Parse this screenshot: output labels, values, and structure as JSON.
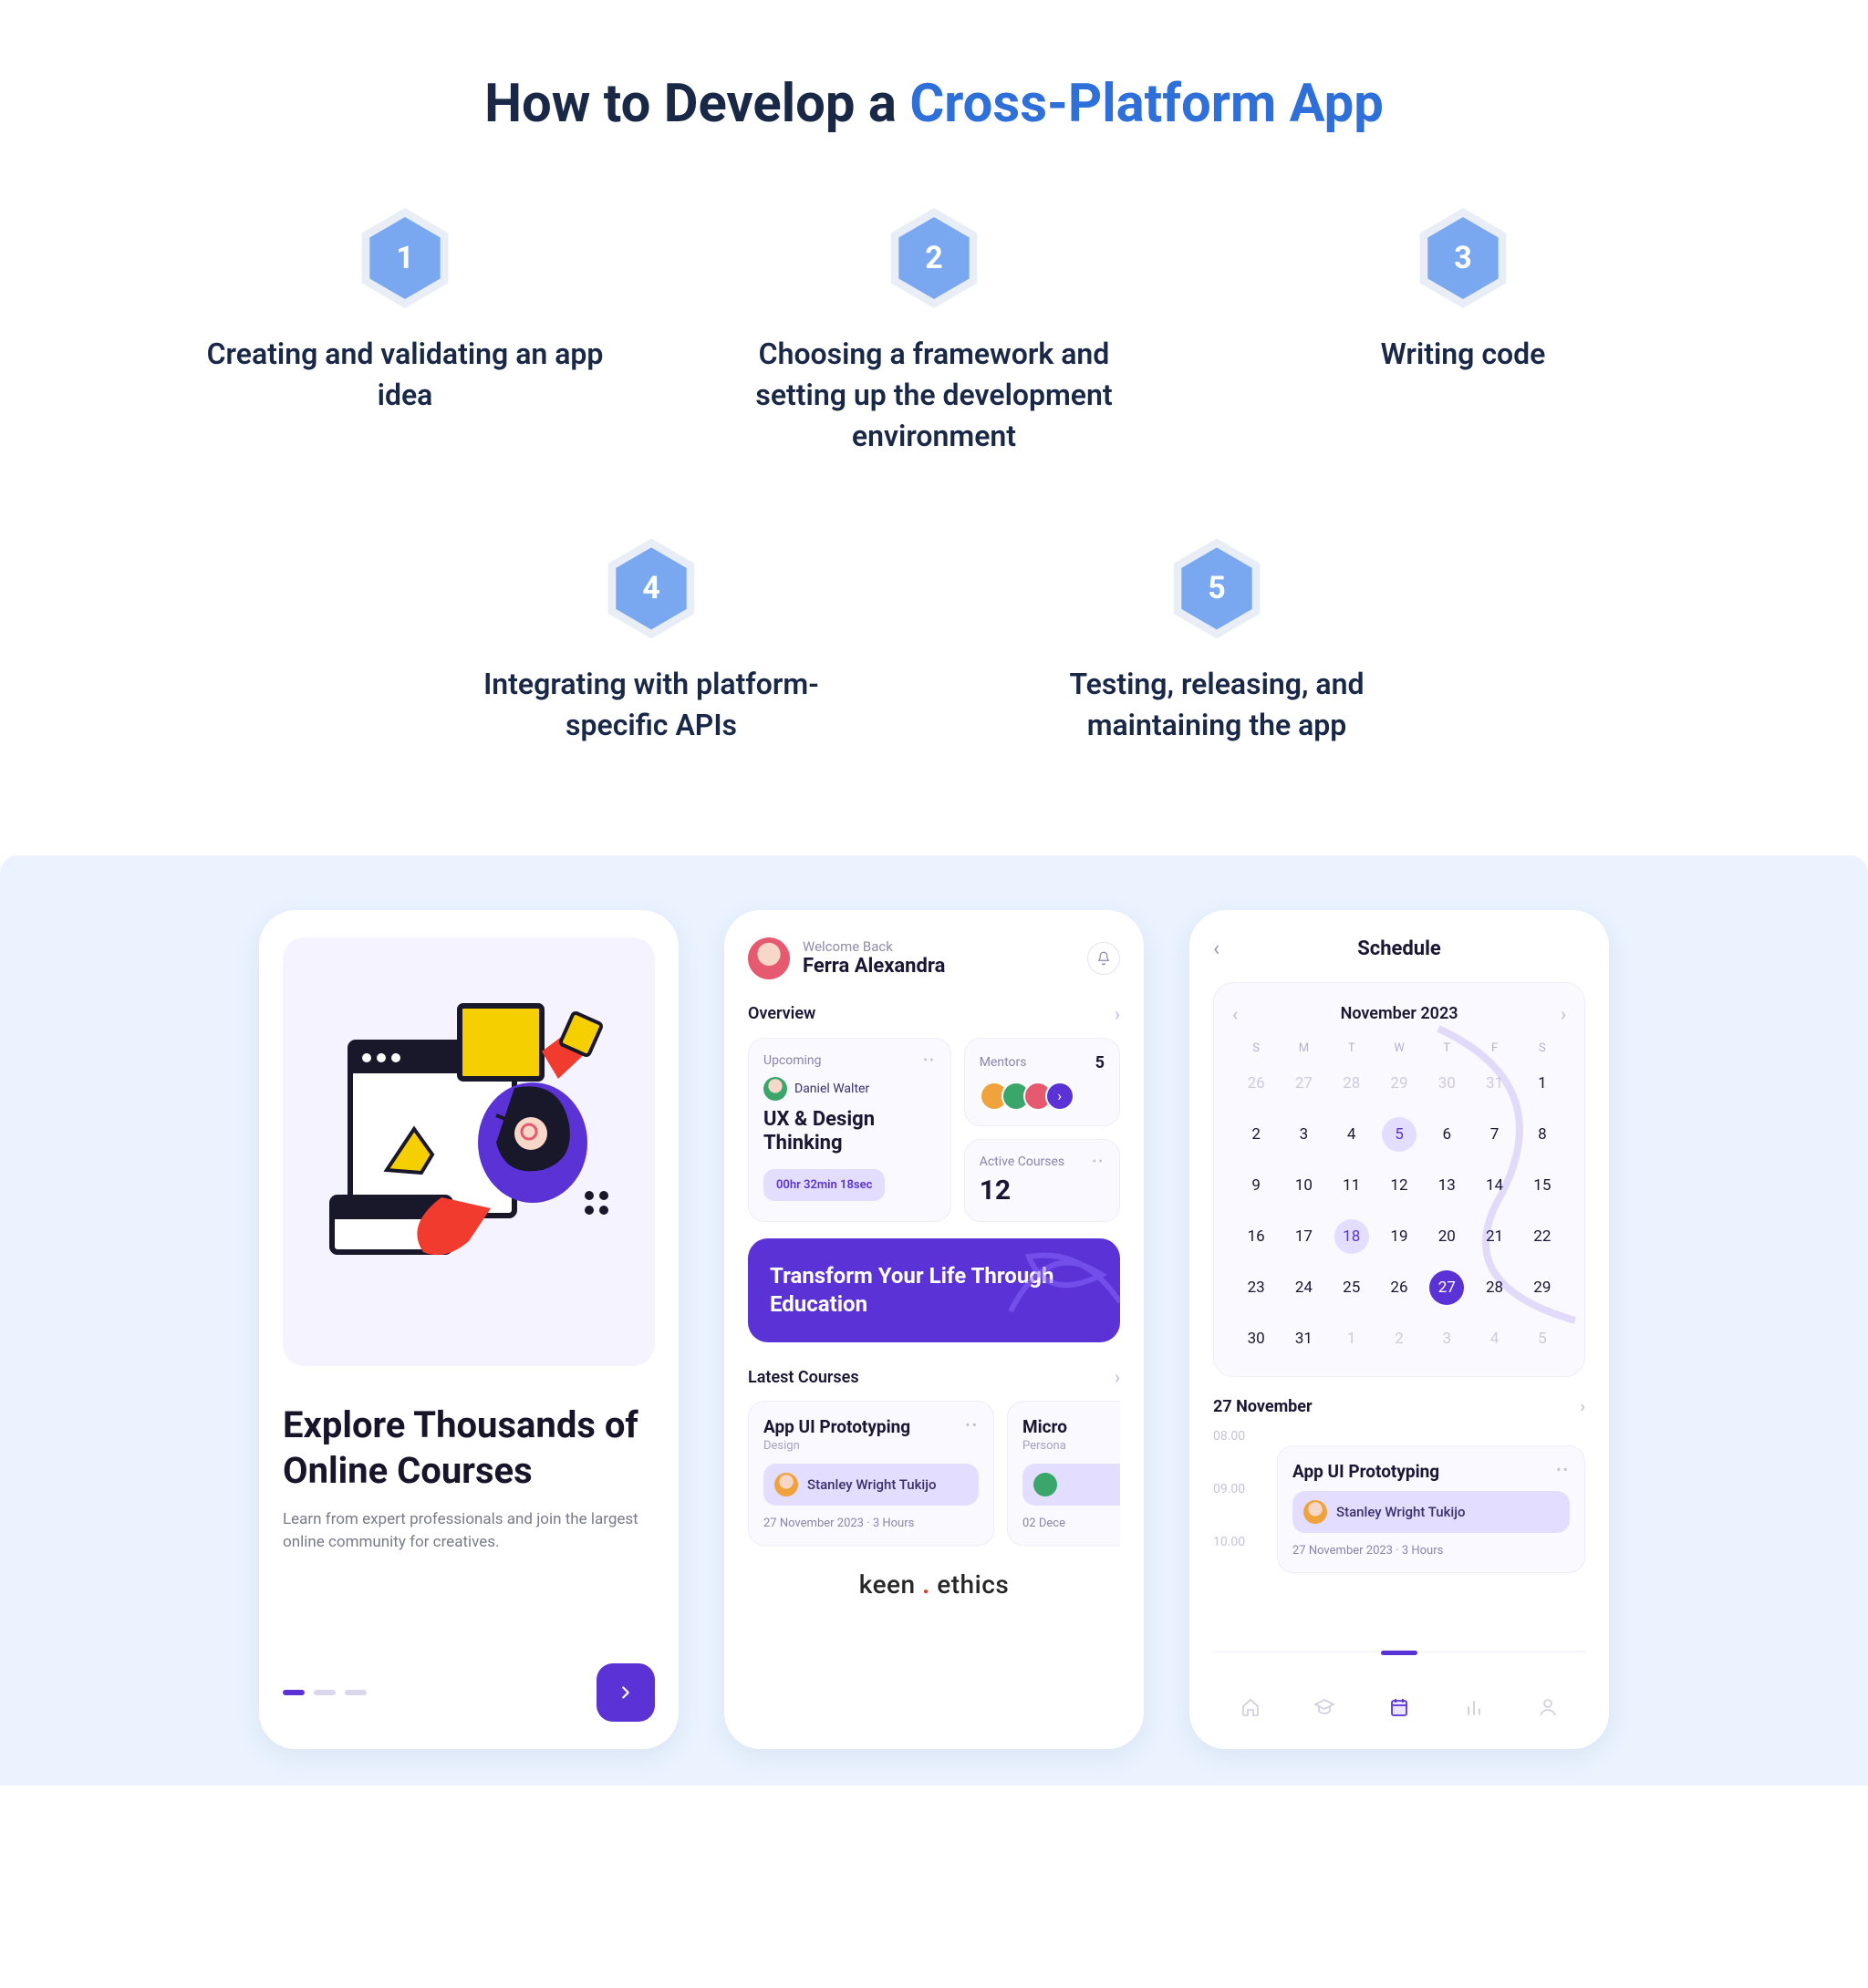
{
  "title": {
    "pre": "How to Develop a ",
    "accent": "Cross-Platform App"
  },
  "steps": [
    {
      "num": "1",
      "label": "Creating and validating an app idea"
    },
    {
      "num": "2",
      "label": "Choosing a framework and setting up the development environment"
    },
    {
      "num": "3",
      "label": "Writing code"
    },
    {
      "num": "4",
      "label": "Integrating with platform-specific APIs"
    },
    {
      "num": "5",
      "label": "Testing, releasing, and maintaining the app"
    }
  ],
  "phone1": {
    "title": "Explore Thousands of Online Courses",
    "subtitle": "Learn from expert professionals and join the largest online community for creatives."
  },
  "phone2": {
    "welcome": "Welcome Back",
    "name": "Ferra Alexandra",
    "overview_label": "Overview",
    "upcoming": {
      "label": "Upcoming",
      "teacher": "Daniel Walter",
      "course": "UX & Design Thinking",
      "timer": "00hr 32min 18sec"
    },
    "mentors": {
      "label": "Mentors",
      "count": "5"
    },
    "active": {
      "label": "Active Courses",
      "count": "12"
    },
    "banner": "Transform Your Life Through Education",
    "latest_label": "Latest Courses",
    "course1": {
      "title": "App UI Prototyping",
      "category": "Design",
      "teacher": "Stanley Wright Tukijo",
      "meta": "27 November 2023 · 3 Hours"
    },
    "course2": {
      "title": "Micro",
      "category": "Persona",
      "meta": "02 Dece"
    },
    "brand_left": "keen",
    "brand_right": "ethics"
  },
  "phone3": {
    "title": "Schedule",
    "month": "November 2023",
    "dow": [
      "S",
      "M",
      "T",
      "W",
      "T",
      "F",
      "S"
    ],
    "weeks": [
      [
        {
          "n": "26",
          "m": 1
        },
        {
          "n": "27",
          "m": 1
        },
        {
          "n": "28",
          "m": 1
        },
        {
          "n": "29",
          "m": 1
        },
        {
          "n": "30",
          "m": 1
        },
        {
          "n": "31",
          "m": 1
        },
        {
          "n": "1"
        }
      ],
      [
        {
          "n": "2"
        },
        {
          "n": "3"
        },
        {
          "n": "4"
        },
        {
          "n": "5",
          "ring": 1
        },
        {
          "n": "6"
        },
        {
          "n": "7"
        },
        {
          "n": "8"
        }
      ],
      [
        {
          "n": "9"
        },
        {
          "n": "10"
        },
        {
          "n": "11"
        },
        {
          "n": "12"
        },
        {
          "n": "13"
        },
        {
          "n": "14"
        },
        {
          "n": "15"
        }
      ],
      [
        {
          "n": "16"
        },
        {
          "n": "17"
        },
        {
          "n": "18",
          "ring": 1
        },
        {
          "n": "19"
        },
        {
          "n": "20"
        },
        {
          "n": "21"
        },
        {
          "n": "22"
        }
      ],
      [
        {
          "n": "23"
        },
        {
          "n": "24"
        },
        {
          "n": "25"
        },
        {
          "n": "26"
        },
        {
          "n": "27",
          "solid": 1
        },
        {
          "n": "28"
        },
        {
          "n": "29"
        }
      ],
      [
        {
          "n": "30"
        },
        {
          "n": "31"
        },
        {
          "n": "1",
          "m": 1
        },
        {
          "n": "2",
          "m": 1
        },
        {
          "n": "3",
          "m": 1
        },
        {
          "n": "4",
          "m": 1
        },
        {
          "n": "5",
          "m": 1
        }
      ]
    ],
    "date_heading": "27 November",
    "hours": [
      "08.00",
      "09.00",
      "10.00"
    ],
    "event": {
      "title": "App UI Prototyping",
      "teacher": "Stanley Wright Tukijo",
      "meta": "27 November 2023 · 3 Hours"
    }
  }
}
